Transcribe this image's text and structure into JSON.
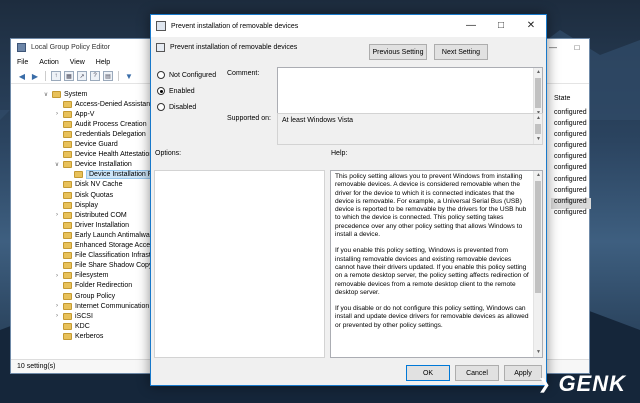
{
  "gpe": {
    "title": "Local Group Policy Editor",
    "menu": [
      "File",
      "Action",
      "View",
      "Help"
    ],
    "tree": [
      {
        "label": "System",
        "level": 0,
        "arrow": "v"
      },
      {
        "label": "Access-Denied Assistanc",
        "level": 1,
        "arrow": ""
      },
      {
        "label": "App-V",
        "level": 1,
        "arrow": ">"
      },
      {
        "label": "Audit Process Creation",
        "level": 1,
        "arrow": ""
      },
      {
        "label": "Credentials Delegation",
        "level": 1,
        "arrow": ""
      },
      {
        "label": "Device Guard",
        "level": 1,
        "arrow": ""
      },
      {
        "label": "Device Health Attestation",
        "level": 1,
        "arrow": ""
      },
      {
        "label": "Device Installation",
        "level": 1,
        "arrow": "v"
      },
      {
        "label": "Device Installation Re",
        "level": 2,
        "arrow": "",
        "selected": true
      },
      {
        "label": "Disk NV Cache",
        "level": 1,
        "arrow": ""
      },
      {
        "label": "Disk Quotas",
        "level": 1,
        "arrow": ""
      },
      {
        "label": "Display",
        "level": 1,
        "arrow": ""
      },
      {
        "label": "Distributed COM",
        "level": 1,
        "arrow": ">"
      },
      {
        "label": "Driver Installation",
        "level": 1,
        "arrow": ""
      },
      {
        "label": "Early Launch Antimalwa",
        "level": 1,
        "arrow": ""
      },
      {
        "label": "Enhanced Storage Acces",
        "level": 1,
        "arrow": ""
      },
      {
        "label": "File Classification Infrast",
        "level": 1,
        "arrow": ""
      },
      {
        "label": "File Share Shadow Copy",
        "level": 1,
        "arrow": ""
      },
      {
        "label": "Filesystem",
        "level": 1,
        "arrow": ">"
      },
      {
        "label": "Folder Redirection",
        "level": 1,
        "arrow": ""
      },
      {
        "label": "Group Policy",
        "level": 1,
        "arrow": ""
      },
      {
        "label": "Internet Communication",
        "level": 1,
        "arrow": ">"
      },
      {
        "label": "iSCSI",
        "level": 1,
        "arrow": ">"
      },
      {
        "label": "KDC",
        "level": 1,
        "arrow": ""
      },
      {
        "label": "Kerberos",
        "level": 1,
        "arrow": ""
      }
    ],
    "state_header": "State",
    "state_cells": [
      "configured",
      "configured",
      "configured",
      "configured",
      "configured",
      "configured",
      "configured",
      "configured",
      "configured",
      "configured"
    ],
    "status": "10 setting(s)"
  },
  "dialog": {
    "title": "Prevent installation of removable devices",
    "header": "Prevent installation of removable devices",
    "prev_button": "Previous Setting",
    "next_button": "Next Setting",
    "radios": [
      {
        "label": "Not Configured",
        "checked": false
      },
      {
        "label": "Enabled",
        "checked": true
      },
      {
        "label": "Disabled",
        "checked": false
      }
    ],
    "comment_label": "Comment:",
    "supported_label": "Supported on:",
    "supported_value": "At least Windows Vista",
    "options_label": "Options:",
    "help_label": "Help:",
    "help_paragraphs": [
      "This policy setting allows you to prevent Windows from installing removable devices. A device is considered removable when the driver for the device to which it is connected indicates that the device is removable. For example, a Universal Serial Bus (USB) device is reported to be removable by the drivers for the USB hub to which the device is connected. This policy setting takes precedence over any other policy setting that allows Windows to install a device.",
      "If you enable this policy setting, Windows is prevented from installing removable devices and existing removable devices cannot have their drivers updated. If you enable this policy setting on a remote desktop server, the policy setting affects redirection of removable devices from a remote desktop client to the remote desktop server.",
      "If you disable or do not configure this policy setting, Windows can install and update device drivers for removable devices as allowed or prevented by other policy settings."
    ],
    "ok_button": "OK",
    "cancel_button": "Cancel",
    "apply_button": "Apply"
  },
  "watermark": "GENK"
}
